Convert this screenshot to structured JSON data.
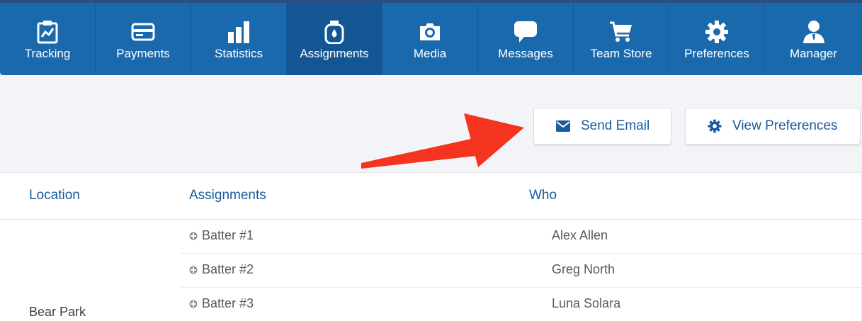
{
  "nav": {
    "items": [
      {
        "label": "Tracking",
        "icon": "clipboard-chart-icon"
      },
      {
        "label": "Payments",
        "icon": "credit-card-icon"
      },
      {
        "label": "Statistics",
        "icon": "bar-chart-icon"
      },
      {
        "label": "Assignments",
        "icon": "water-bottle-icon",
        "active": true
      },
      {
        "label": "Media",
        "icon": "camera-icon"
      },
      {
        "label": "Messages",
        "icon": "speech-bubble-icon"
      },
      {
        "label": "Team Store",
        "icon": "shopping-cart-icon"
      },
      {
        "label": "Preferences",
        "icon": "gear-icon"
      },
      {
        "label": "Manager",
        "icon": "manager-person-icon"
      }
    ]
  },
  "actions": {
    "send_email": "Send Email",
    "view_preferences": "View Preferences"
  },
  "table": {
    "headers": {
      "location": "Location",
      "assignments": "Assignments",
      "who": "Who"
    },
    "location": "Bear Park",
    "rows": [
      {
        "assignment": "Batter #1",
        "who": "Alex Allen"
      },
      {
        "assignment": "Batter #2",
        "who": "Greg North"
      },
      {
        "assignment": "Batter #3",
        "who": "Luna Solara"
      }
    ]
  },
  "colors": {
    "nav_bg": "#1a69ad",
    "nav_active": "#145694",
    "accent_text": "#1a5b9e",
    "annotation_arrow": "#f5341f"
  }
}
